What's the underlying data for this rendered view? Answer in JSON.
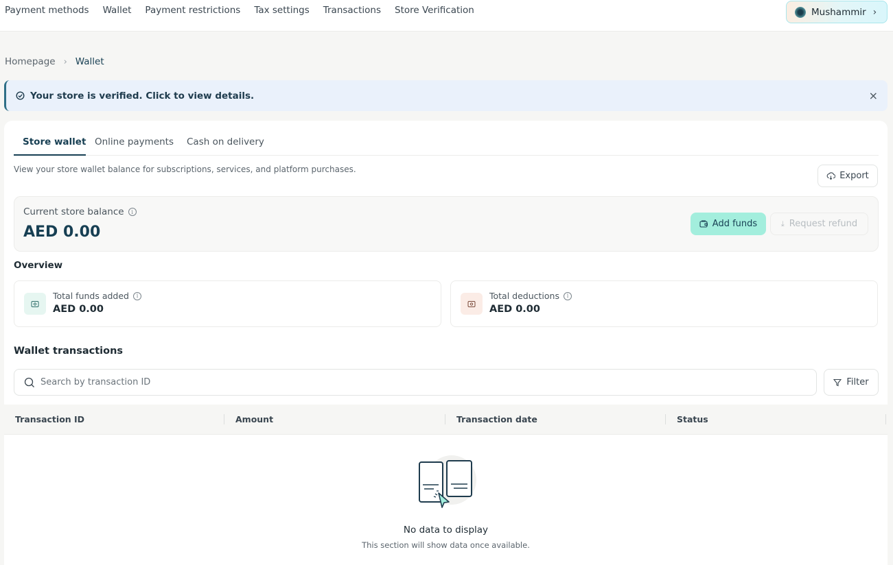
{
  "topnav": {
    "items": [
      "Payment methods",
      "Wallet",
      "Payment restrictions",
      "Tax settings",
      "Transactions",
      "Store Verification"
    ],
    "user_name": "Mushammir"
  },
  "breadcrumb": {
    "home": "Homepage",
    "current": "Wallet"
  },
  "banner": {
    "text": "Your store is verified. Click to view details.",
    "close_icon": "close-icon"
  },
  "tabs": [
    "Store wallet",
    "Online payments",
    "Cash on delivery"
  ],
  "wallet": {
    "description": "View your store wallet balance for subscriptions, services, and platform purchases.",
    "export_label": "Export",
    "balance_label": "Current store balance",
    "balance_value": "AED 0.00",
    "add_funds_label": "Add funds",
    "request_refund_label": "Request refund"
  },
  "overview": {
    "title": "Overview",
    "total_funds_label": "Total funds added",
    "total_funds_value": "AED 0.00",
    "total_deductions_label": "Total deductions",
    "total_deductions_value": "AED 0.00"
  },
  "transactions": {
    "title": "Wallet transactions",
    "search_placeholder": "Search by transaction ID",
    "filter_label": "Filter",
    "columns": [
      "Transaction ID",
      "Amount",
      "Transaction date",
      "Status"
    ],
    "empty_title": "No data to display",
    "empty_subtitle": "This section will show data once available."
  },
  "colors": {
    "primary": "#173f53",
    "accent": "#a3eedd",
    "banner_bg": "#eaf1fb",
    "page_bg": "#f6f6f4"
  }
}
